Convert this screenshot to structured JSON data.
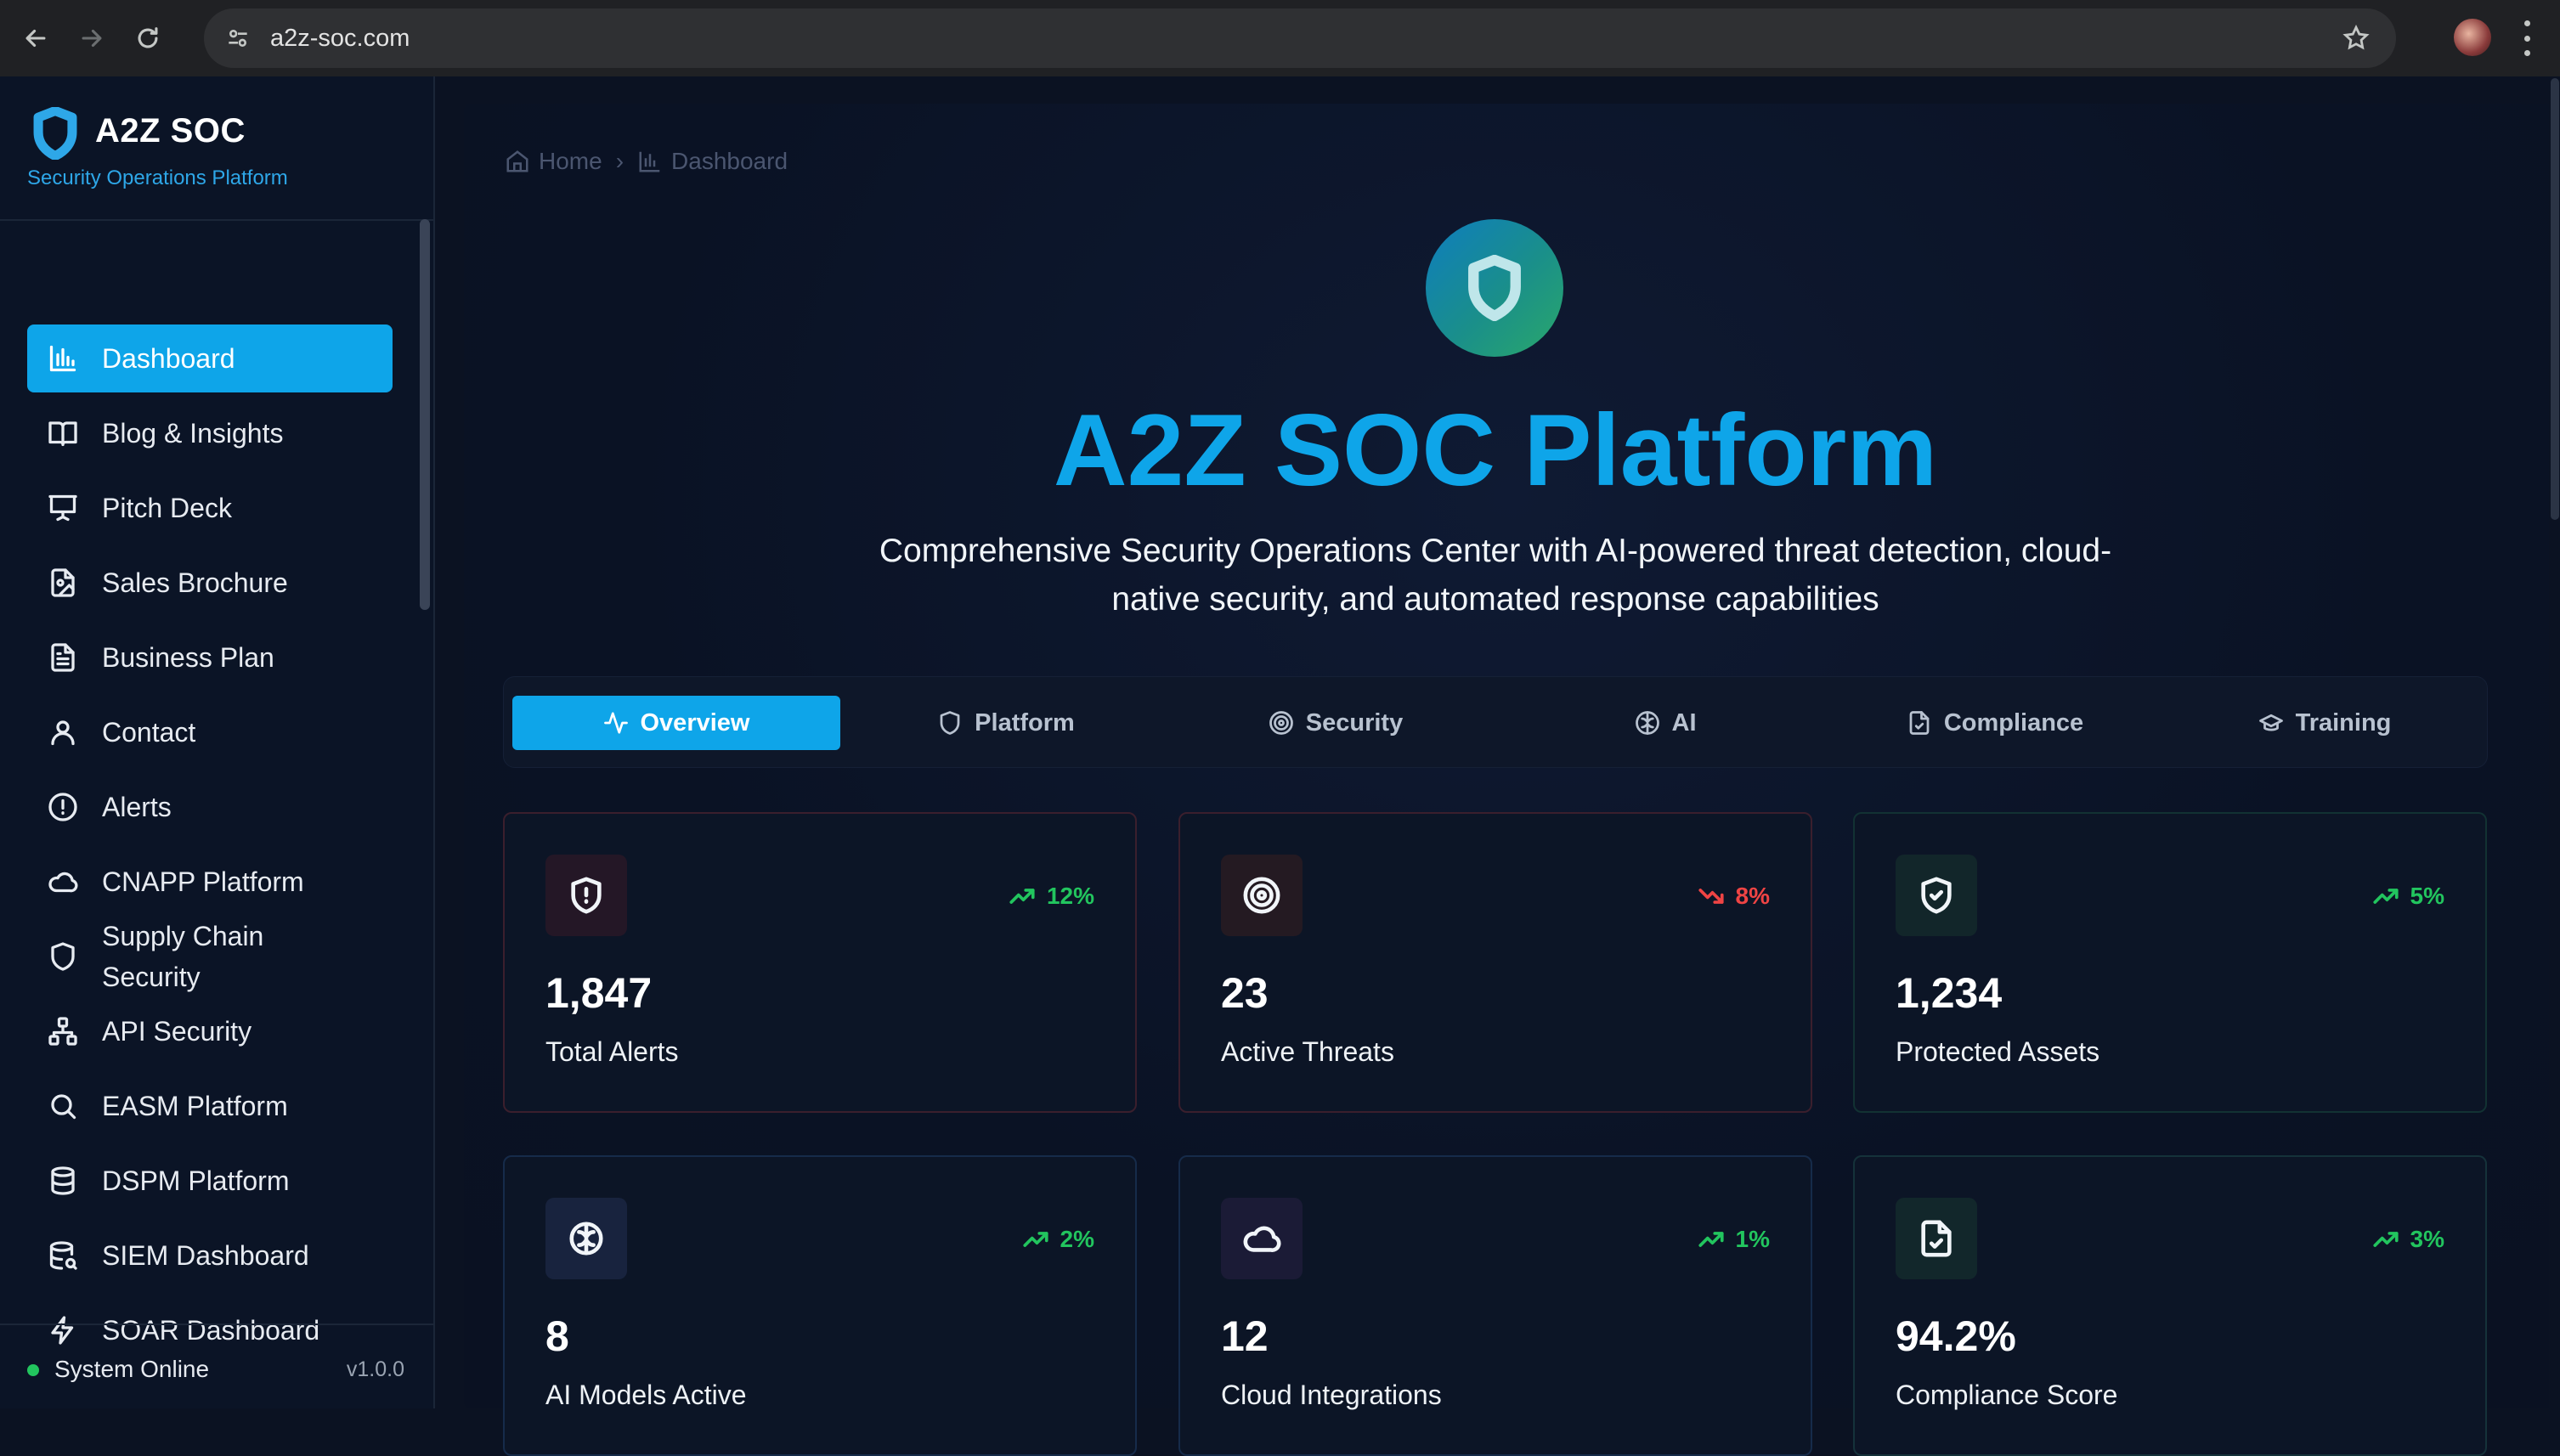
{
  "browser": {
    "url": "a2z-soc.com",
    "icons": [
      "back-icon",
      "forward-icon",
      "reload-icon",
      "site-settings-icon",
      "star-icon",
      "profile-avatar",
      "more-icon"
    ]
  },
  "sidebar": {
    "brand_title": "A2Z SOC",
    "brand_subtitle": "Security Operations Platform",
    "items": [
      {
        "label": "Dashboard",
        "icon": "bar-chart-icon",
        "active": true
      },
      {
        "label": "Blog & Insights",
        "icon": "book-icon"
      },
      {
        "label": "Pitch Deck",
        "icon": "presentation-icon"
      },
      {
        "label": "Sales Brochure",
        "icon": "file-image-icon"
      },
      {
        "label": "Business Plan",
        "icon": "file-text-icon"
      },
      {
        "label": "Contact",
        "icon": "user-icon"
      },
      {
        "label": "Alerts",
        "icon": "alert-circle-icon"
      },
      {
        "label": "CNAPP Platform",
        "icon": "cloud-icon"
      },
      {
        "label": "Supply Chain Security",
        "icon": "shield-icon"
      },
      {
        "label": "API Security",
        "icon": "network-icon"
      },
      {
        "label": "EASM Platform",
        "icon": "search-icon"
      },
      {
        "label": "DSPM Platform",
        "icon": "database-icon"
      },
      {
        "label": "SIEM Dashboard",
        "icon": "database-search-icon"
      },
      {
        "label": "SOAR Dashboard",
        "icon": "zap-icon"
      }
    ],
    "status": "System Online",
    "version": "v1.0.0"
  },
  "breadcrumb": {
    "home": "Home",
    "current": "Dashboard"
  },
  "hero": {
    "title": "A2Z SOC Platform",
    "description": "Comprehensive Security Operations Center with AI-powered threat detection, cloud-native security, and automated response capabilities"
  },
  "tabs": [
    {
      "label": "Overview",
      "icon": "activity-icon",
      "active": true
    },
    {
      "label": "Platform",
      "icon": "shield-icon"
    },
    {
      "label": "Security",
      "icon": "target-icon"
    },
    {
      "label": "AI",
      "icon": "brain-icon"
    },
    {
      "label": "Compliance",
      "icon": "file-check-icon"
    },
    {
      "label": "Training",
      "icon": "graduation-cap-icon"
    }
  ],
  "stats": [
    {
      "value": "1,847",
      "label": "Total Alerts",
      "trend": "12%",
      "direction": "up",
      "icon": "shield-alert-icon",
      "icon_bg": "#241726"
    },
    {
      "value": "23",
      "label": "Active Threats",
      "trend": "8%",
      "direction": "down",
      "icon": "target-icon",
      "icon_bg": "#241a22"
    },
    {
      "value": "1,234",
      "label": "Protected Assets",
      "trend": "5%",
      "direction": "up",
      "icon": "shield-check-icon",
      "icon_bg": "#12262a"
    },
    {
      "value": "8",
      "label": "AI Models Active",
      "trend": "2%",
      "direction": "up",
      "icon": "brain-icon",
      "icon_bg": "#18233e"
    },
    {
      "value": "12",
      "label": "Cloud Integrations",
      "trend": "1%",
      "direction": "up",
      "icon": "cloud-icon",
      "icon_bg": "#1b1b36"
    },
    {
      "value": "94.2%",
      "label": "Compliance Score",
      "trend": "3%",
      "direction": "up",
      "icon": "file-check-icon",
      "icon_bg": "#12272b"
    }
  ],
  "colors": {
    "accent": "#0ea5e9",
    "up": "#22c55e",
    "down": "#ef4444",
    "status_online": "#22c55e"
  }
}
